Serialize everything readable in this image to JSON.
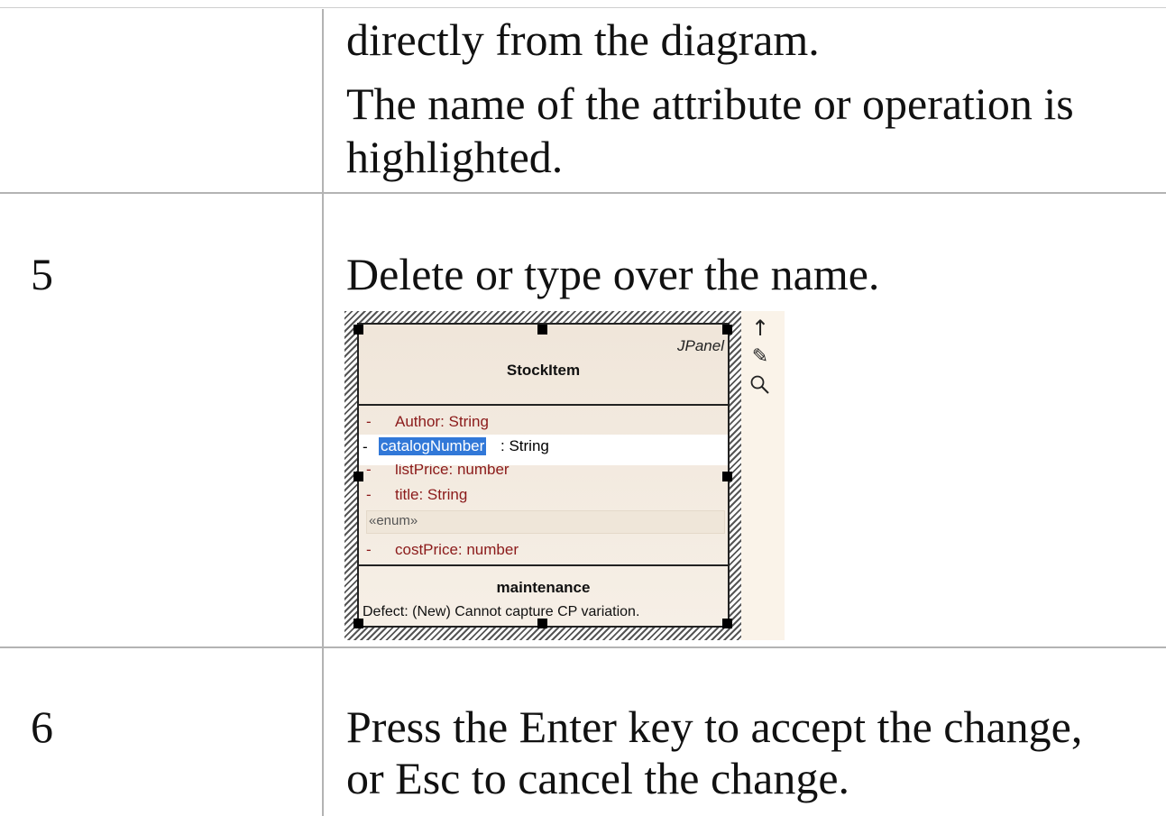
{
  "rows": [
    {
      "step": "",
      "lines": [
        "directly from the diagram.",
        "The name of the attribute or operation is",
        "highlighted."
      ]
    },
    {
      "step": "5",
      "lines": [
        "Delete or type over the name."
      ]
    },
    {
      "step": "6",
      "lines": [
        "Press the Enter key to accept the change,",
        "or Esc to cancel the change."
      ]
    }
  ],
  "diagram": {
    "stereotype": "JPanel",
    "class_name": "StockItem",
    "attributes": [
      {
        "visibility": "-",
        "text": "Author:  String"
      },
      {
        "visibility": "-",
        "text": "listPrice:  number"
      },
      {
        "visibility": "-",
        "text": "title:  String"
      }
    ],
    "editing": {
      "visibility": "-",
      "selected": "catalogNumber",
      "rest": ": String"
    },
    "enum_section": {
      "label": "«enum»",
      "visibility": "-",
      "text": "costPrice:  number"
    },
    "compartment_title": "maintenance",
    "compartment_text": "Defect: (New) Cannot capture CP variation.",
    "toolbar_icons": [
      "arrow-up-icon",
      "paint-brush-icon",
      "magnifier-icon"
    ],
    "colors": {
      "attribute": "#8b1a1a",
      "selection": "#3178d8",
      "class_fill": "#f0e6da"
    }
  }
}
